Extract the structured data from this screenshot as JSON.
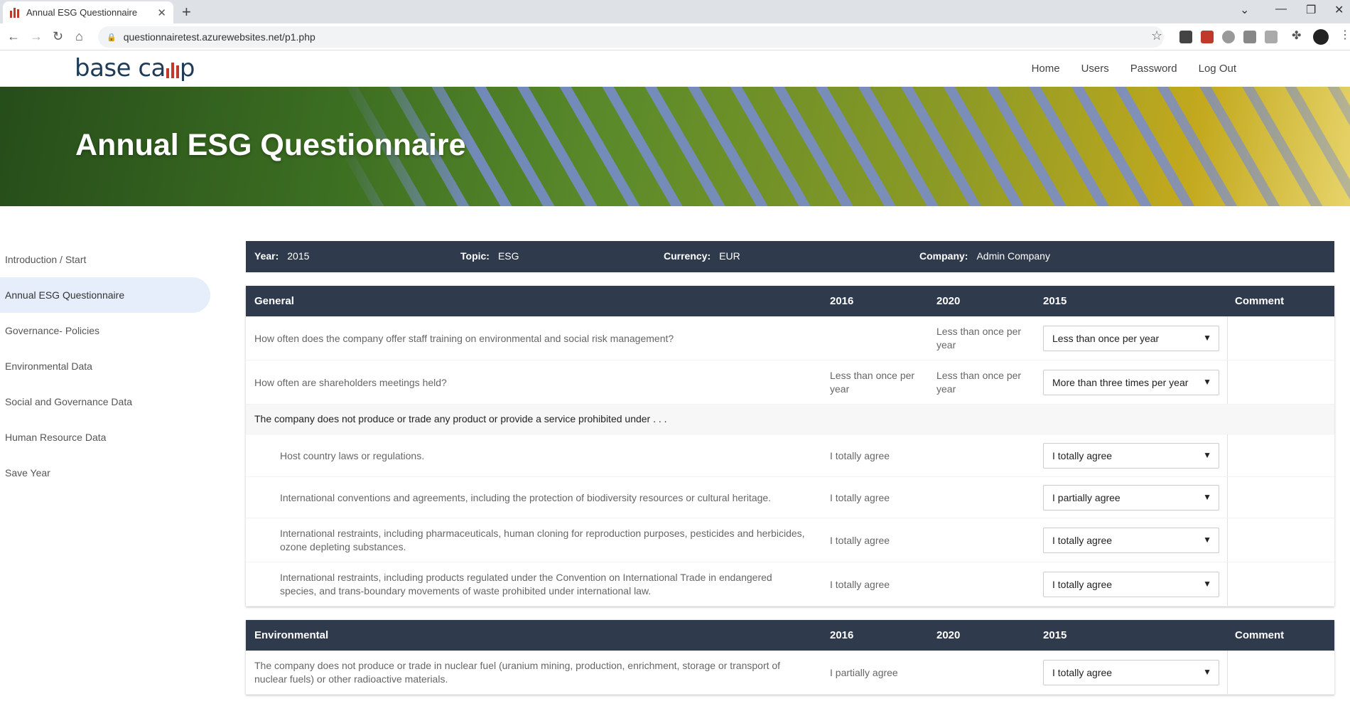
{
  "browser": {
    "tab_title": "Annual ESG Questionnaire",
    "url": "questionnairetest.azurewebsites.net/p1.php"
  },
  "site": {
    "logo": {
      "left": "base ca",
      "right": "p"
    },
    "nav": [
      "Home",
      "Users",
      "Password",
      "Log Out"
    ],
    "hero_title": "Annual ESG Questionnaire"
  },
  "sidebar": {
    "items": [
      {
        "label": "Introduction / Start"
      },
      {
        "label": "Annual ESG Questionnaire",
        "active": true
      },
      {
        "label": "Governance- Policies"
      },
      {
        "label": "Environmental Data"
      },
      {
        "label": "Social and Governance Data"
      },
      {
        "label": "Human Resource Data"
      },
      {
        "label": "Save Year"
      }
    ]
  },
  "info": {
    "year_label": "Year:",
    "year": "2015",
    "topic_label": "Topic:",
    "topic": "ESG",
    "currency_label": "Currency:",
    "currency": "EUR",
    "company_label": "Company:",
    "company": "Admin Company"
  },
  "general": {
    "title": "General",
    "col_2016": "2016",
    "col_2020": "2020",
    "col_2015": "2015",
    "col_comment": "Comment",
    "rows": [
      {
        "q": "How often does the company offer staff training on environmental and social risk management?",
        "v2016": "",
        "v2020": "Less than once per year",
        "sel": "Less than once per year"
      },
      {
        "q": "How often are shareholders meetings held?",
        "v2016": "Less than once per year",
        "v2020": "Less than once per year",
        "sel": "More than three times per year"
      }
    ],
    "group_label": "The company does not produce or trade any product or provide a service prohibited under . . .",
    "sub_rows": [
      {
        "q": "Host country laws or regulations.",
        "v2016": "I totally agree",
        "sel": "I totally agree"
      },
      {
        "q": "International conventions and agreements, including the protection of biodiversity resources or cultural heritage.",
        "v2016": "I totally agree",
        "sel": "I partially agree"
      },
      {
        "q": "International restraints, including pharmaceuticals, human cloning for reproduction purposes, pesticides and herbicides, ozone depleting substances.",
        "v2016": "I totally agree",
        "sel": "I totally agree"
      },
      {
        "q": "International restraints, including products regulated under the Convention on International Trade in endangered species, and trans-boundary movements of waste prohibited under international law.",
        "v2016": "I totally agree",
        "sel": "I totally agree"
      }
    ]
  },
  "environmental": {
    "title": "Environmental",
    "col_2016": "2016",
    "col_2020": "2020",
    "col_2015": "2015",
    "col_comment": "Comment",
    "rows": [
      {
        "q": "The company does not produce or trade in nuclear fuel (uranium mining, production, enrichment, storage or transport of nuclear fuels) or other radioactive materials.",
        "v2016": "I partially agree",
        "sel": "I totally agree"
      }
    ]
  },
  "colors": {
    "header_bg": "#2f3a4d",
    "sidebar_active": "#e6eefb",
    "accent": "#c0392b"
  }
}
